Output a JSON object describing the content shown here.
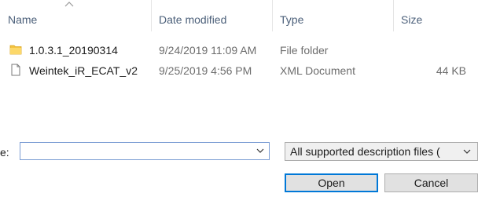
{
  "columns": {
    "name": "Name",
    "date": "Date modified",
    "type": "Type",
    "size": "Size"
  },
  "files": [
    {
      "icon": "folder-icon",
      "name": "1.0.3.1_20190314",
      "date": "9/24/2019 11:09 AM",
      "type": "File folder",
      "size": ""
    },
    {
      "icon": "document-icon",
      "name": "Weintek_iR_ECAT_v2",
      "date": "9/25/2019 4:56 PM",
      "type": "XML Document",
      "size": "44 KB"
    }
  ],
  "filename": {
    "label": "e:",
    "value": ""
  },
  "filetype": {
    "selected": "All supported description files ("
  },
  "buttons": {
    "open": "Open",
    "cancel": "Cancel"
  },
  "colors": {
    "header_text": "#4c607a",
    "focus_border": "#0078d7",
    "folder": "#f5c542"
  }
}
